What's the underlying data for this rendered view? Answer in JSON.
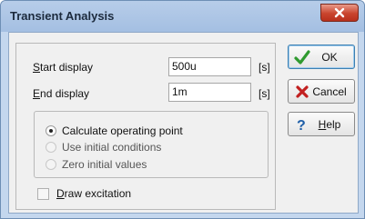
{
  "window": {
    "title": "Transient Analysis"
  },
  "fields": {
    "start": {
      "label_accel": "S",
      "label_rest": "tart display",
      "value": "500u",
      "unit": "[s]"
    },
    "end": {
      "label_accel": "E",
      "label_pre": "",
      "label_rest": "nd display",
      "value": "1m",
      "unit": "[s]"
    }
  },
  "options": [
    {
      "label": "Calculate operating point",
      "selected": true
    },
    {
      "label": "Use initial conditions",
      "selected": false
    },
    {
      "label": "Zero initial values",
      "selected": false
    }
  ],
  "draw_excitation": {
    "label_accel": "D",
    "label_rest": "raw excitation",
    "checked": false
  },
  "buttons": {
    "ok": "OK",
    "cancel": "Cancel",
    "help_accel": "H",
    "help_rest": "elp"
  },
  "colors": {
    "ok_check": "#2f9a2f",
    "cancel_x": "#c22020",
    "help_q": "#1f5fa8"
  },
  "icons": {
    "ok": "check-icon",
    "cancel": "x-icon",
    "help": "question-icon",
    "close": "close-icon"
  }
}
